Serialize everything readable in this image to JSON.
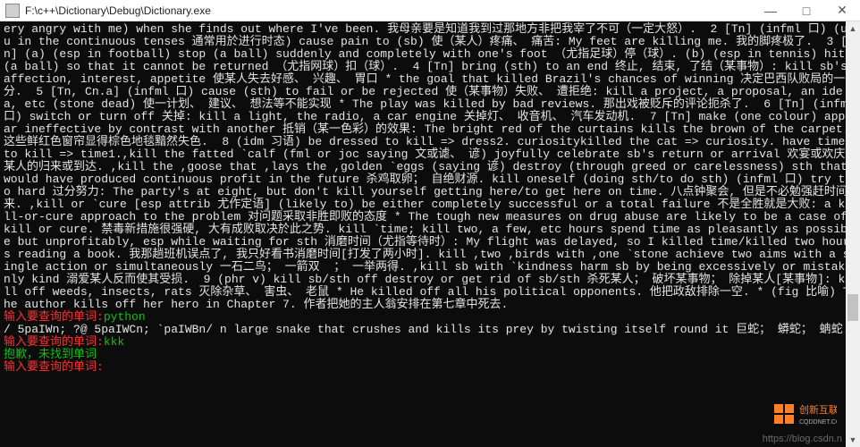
{
  "titlebar": {
    "path": "F:\\c++\\Dictionary\\Debug\\Dictionary.exe"
  },
  "window_controls": {
    "minimize": "—",
    "maximize": "□",
    "close": "✕"
  },
  "scrollbar": {
    "up": "▲",
    "down": "▼"
  },
  "console": {
    "dict_body": "ery angry with me) when she finds out where I've been. 我母亲要是知道我到过那地方非把我宰了不可（一定大怒）.  2 [Tn] (infml 口) (usu in the continuous tenses 通常用於进行时态) cause pain to (sb) 使（某人）疼痛、 痛苦: My feet are killing me. 我的脚疼极了.  3 [Tn] (a) (esp in football) stop (a ball) suddenly and completely with one's foot （尤指足球）停（球）. (b) (esp in tennis) hit (a ball) so that it cannot be returned （尤指网球）扣（球）.  4 [Tn] bring (sth) to an end 终止, 结束, 了结（某事物）: kill sb's affection, interest, appetite 使某人失去好感、 兴趣、 胃口 * the goal that killed Brazil's chances of winning 决定巴西队败局的一分.  5 [Tn, Cn.a] (infml 口) cause (sth) to fail or be rejected 使（某事物）失败、 遭拒绝: kill a project, a proposal, an idea, etc (stone dead) 使一计划、 建议、 想法等不能实现 * The play was killed by bad reviews. 那出戏被贬斥的评论扼杀了.  6 [Tn] (infml 口) switch or turn off 关掉: kill a light, the radio, a car engine 关掉灯、 收音机、 汽车发动机.  7 [Tn] make (one colour) appear ineffective by contrast with another 抵销（某一色彩）的效果: The bright red of the curtains kills the brown of the carpet. 这些鲜红色窗帘显得棕色地毯黯然失色.  8 (idm 习语) be dressed to kill => dress2. curiositykilled the cat => curiosity. have time to kill => time1.,kill the fatted `calf (fml or joc saying 文或谑、 谚) joyfully celebrate sb's return or arrival 欢宴或欢庆某人的归来或到达. ,kill the ,goose that ,lays the ,golden `eggs (saying 谚) destroy (through greed or carelessness) sth that would have produced continuous profit in the future 杀鸡取卵； 自绝财源. kill oneself (doing sth/to do sth) (infml 口) try too hard 过分努力: The party's at eight, but don't kill yourself getting here/to get here on time. 八点钟聚会, 但是不必勉强赶时间来. ,kill or `cure [esp attrib 尤作定语] (likely to) be either completely successful or a total failure 不是全胜就是大败: a kill-or-cure approach to the problem 对问题采取非胜即败的态度 * The tough new measures on drug abuse are likely to be a case of kill or cure. 禁毒新措施很强硬, 大有成败取决於此之势. kill `time; kill two, a few, etc hours spend time as pleasantly as possible but unprofitably, esp while waiting for sth 消磨时间（尤指等待时）: My flight was delayed, so I killed time/killed two hours reading a book. 我那趟班机误点了, 我只好看书消磨时间[打发了两小时]. kill ,two ,birds with ,one `stone achieve two aims with a single action or simultaneously 一石二鸟； 一箭双  ； 一举两得. ,kill sb with `kindness harm sb by being excessively or mistakenly kind 溺爱某人反而使其受损.  9 (phr v) kill sb/sth off destroy or get rid of sb/sth 杀死某人； 破坏某事物； 除掉某人[某事物]: kill off weeds, insects, rats 灭除杂草、 害虫、 老鼠 * He killed off all his political opponents. 他把政敌排除一空. * (fig 比喻) The author kills off her hero in Chapter 7. 作者把她的主人翁安排在第七章中死去.",
    "prompt_label": "输入要查询的单词:",
    "query1": "python",
    "result1": "/ 5paIWn; ?@ 5paIWCn; `paIWBn/ n large snake that crushes and kills its prey by twisting itself round it 巨蛇； 蟒蛇； 蚺蛇.",
    "query2": "kkk",
    "error_line": "抱歉，未找到单词",
    "query3": ""
  },
  "watermark": {
    "text": "https://blog.csdn.n"
  }
}
